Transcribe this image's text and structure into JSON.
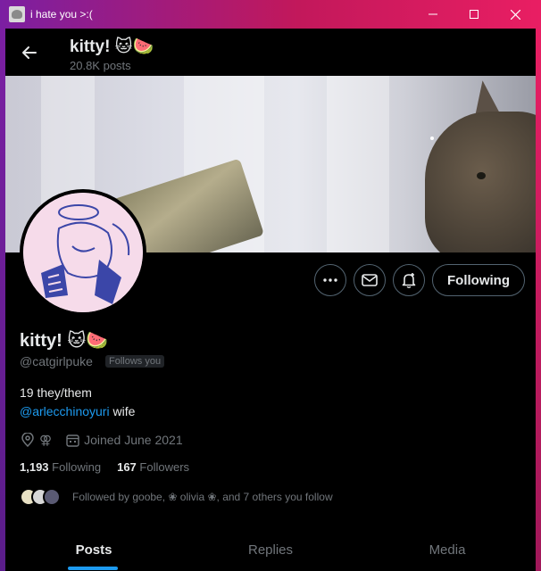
{
  "window": {
    "title": "i hate you >:(",
    "minimize_glyph": "—",
    "maximize_glyph": "☐",
    "close_glyph": "✕"
  },
  "header": {
    "name": "kitty! 🐱🍉",
    "post_count": "20.8K posts"
  },
  "profile": {
    "name": "kitty! 🐱🍉",
    "handle": "@catgirlpuke",
    "follows_you_badge": "Follows you",
    "bio_line1": "19 they/them",
    "bio_mention": "@arlecchinoyuri",
    "bio_line2_rest": " wife",
    "location_glyph": "⚢",
    "joined": "Joined June 2021",
    "following_count": "1,193",
    "following_label": "Following",
    "followers_count": "167",
    "followers_label": "Followers",
    "followed_by_text": "Followed by goobe, ❀ olivia ❀, and 7 others you follow"
  },
  "actions": {
    "following_button": "Following"
  },
  "tabs": [
    {
      "label": "Posts",
      "active": true
    },
    {
      "label": "Replies",
      "active": false
    },
    {
      "label": "Media",
      "active": false
    }
  ],
  "colors": {
    "accent": "#1d9bf0",
    "titlebar_start": "#7b1fa2",
    "titlebar_end": "#e91e63"
  },
  "icons": [
    "back-arrow-icon",
    "more-icon",
    "message-icon",
    "notification-bell-icon",
    "location-icon",
    "calendar-icon"
  ]
}
